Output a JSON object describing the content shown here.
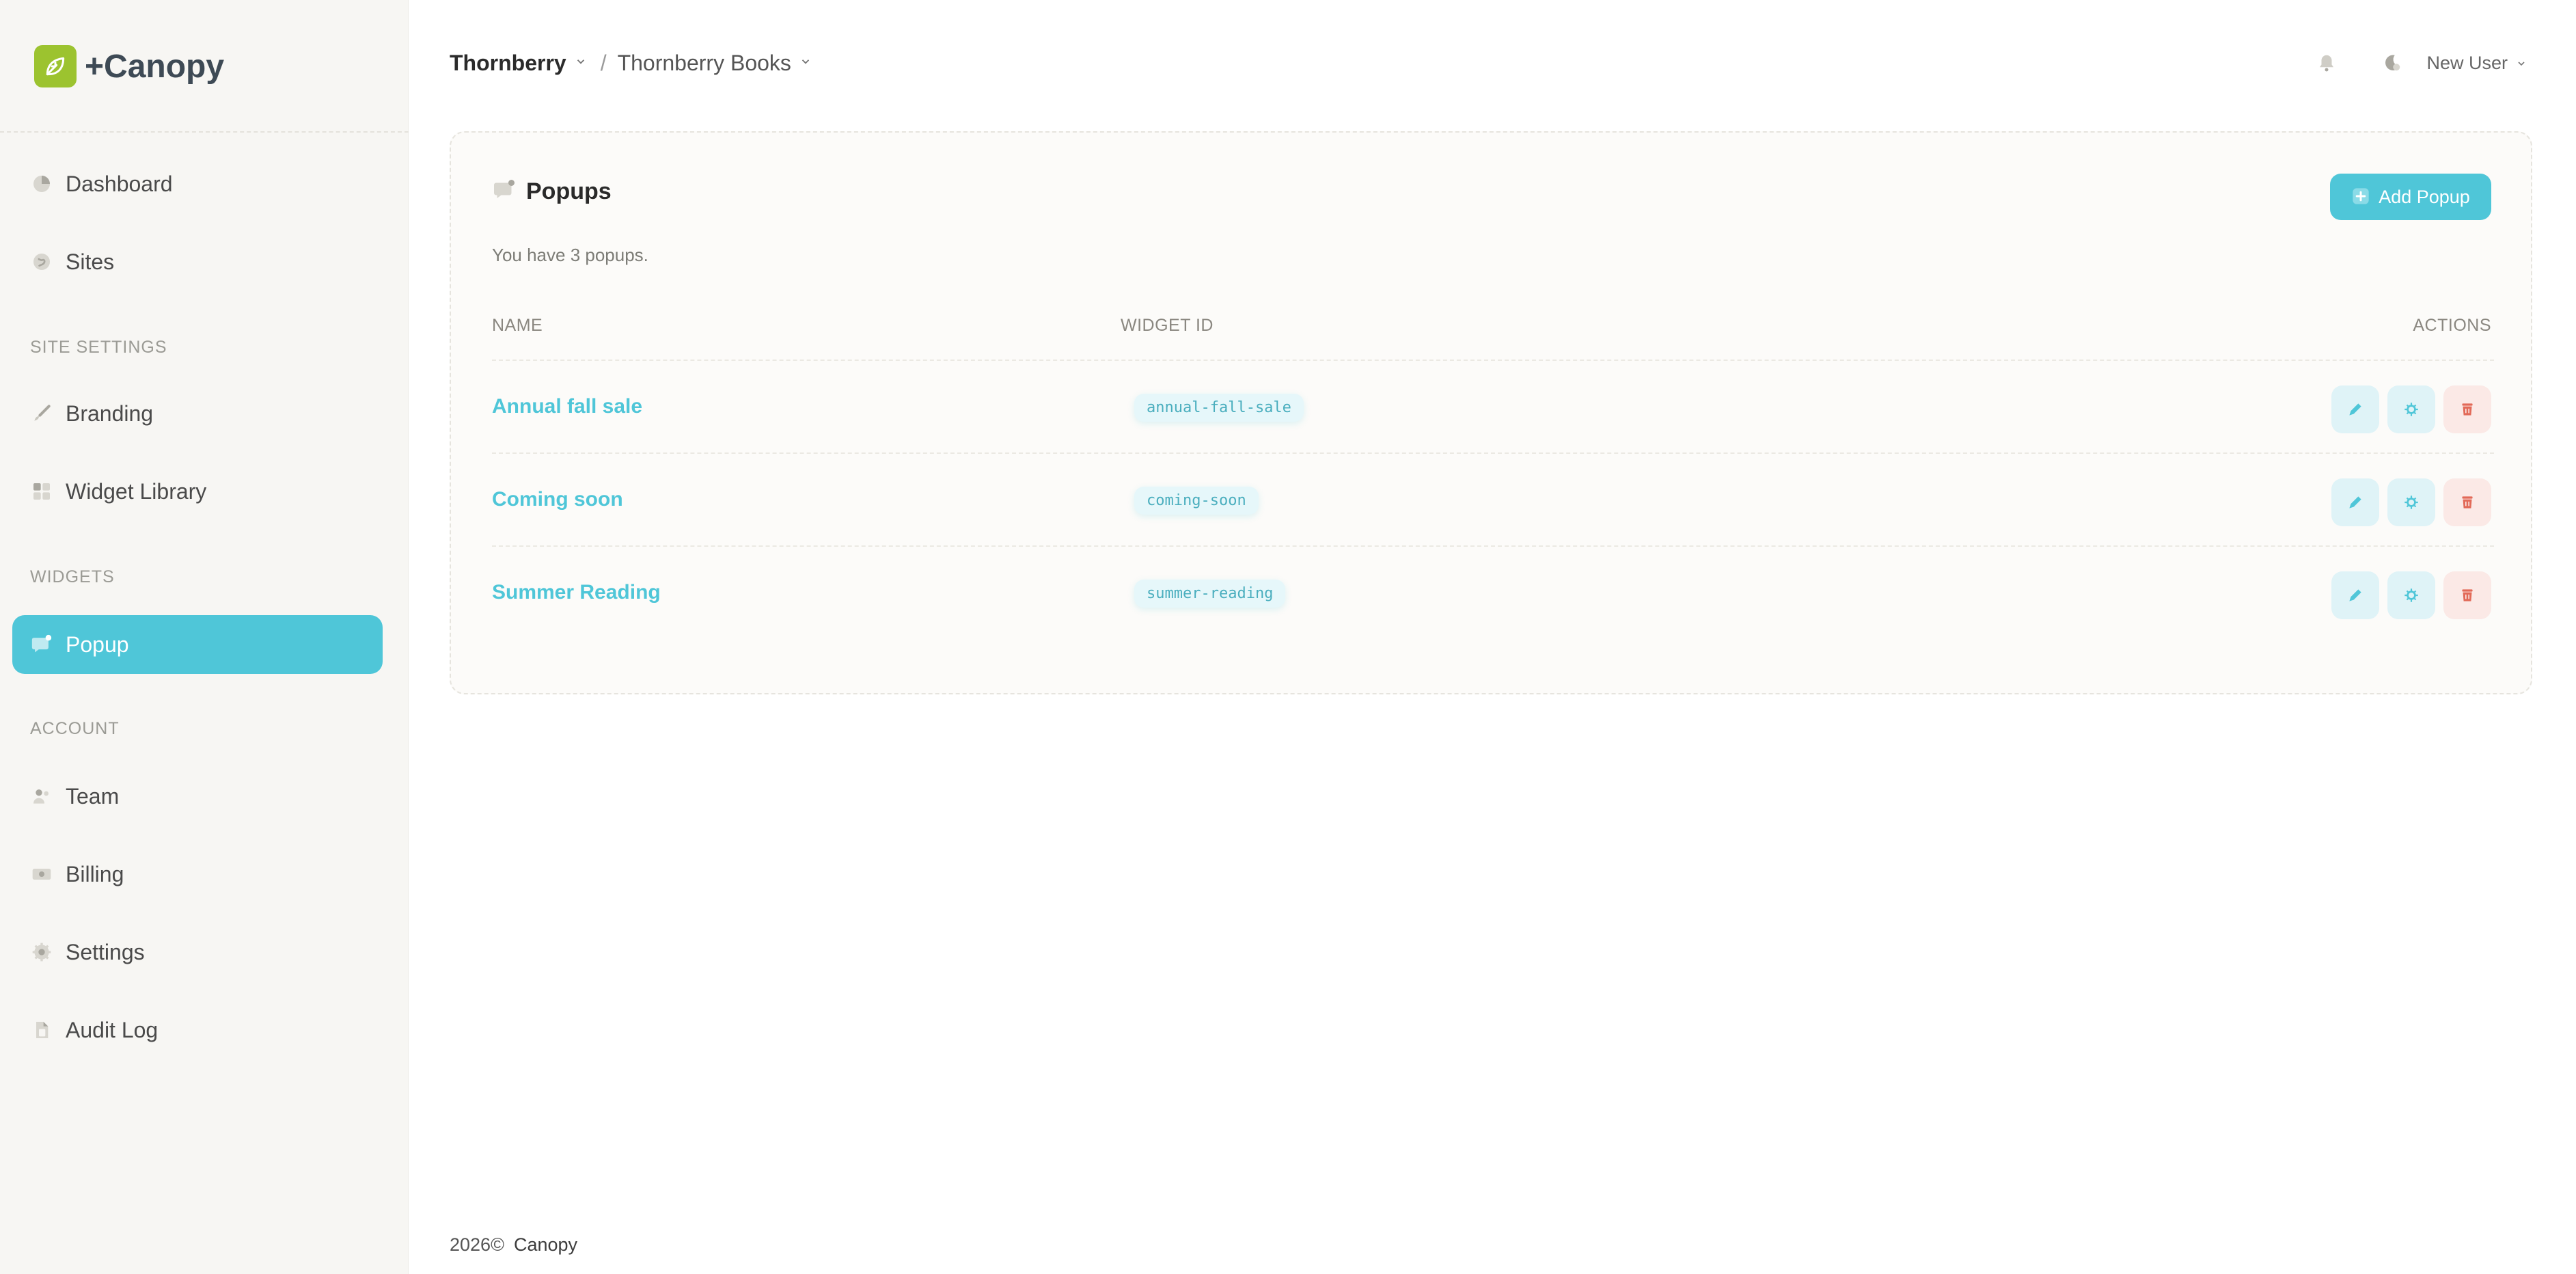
{
  "app": {
    "name": "+Canopy"
  },
  "sidebar": {
    "main": [
      {
        "label": "Dashboard",
        "icon": "pie-chart-icon"
      },
      {
        "label": "Sites",
        "icon": "globe-icon"
      }
    ],
    "sections": {
      "site_settings": "SITE SETTINGS",
      "widgets": "WIDGETS",
      "account": "ACCOUNT"
    },
    "site_settings": [
      {
        "label": "Branding",
        "icon": "brush-icon"
      },
      {
        "label": "Widget Library",
        "icon": "grid-icon"
      }
    ],
    "widgets": [
      {
        "label": "Popup",
        "icon": "chat-bubble-icon",
        "active": true
      }
    ],
    "account": [
      {
        "label": "Team",
        "icon": "users-icon"
      },
      {
        "label": "Billing",
        "icon": "money-icon"
      },
      {
        "label": "Settings",
        "icon": "gear-icon"
      },
      {
        "label": "Audit Log",
        "icon": "document-icon"
      }
    ]
  },
  "header": {
    "org": "Thornberry",
    "separator": "/",
    "site": "Thornberry Books",
    "user": "New User"
  },
  "popups": {
    "title": "Popups",
    "subtitle": "You have 3 popups.",
    "add_label": "Add Popup",
    "columns": {
      "name": "NAME",
      "widget_id": "WIDGET ID",
      "actions": "ACTIONS"
    },
    "rows": [
      {
        "name": "Annual fall sale",
        "widget_id": "annual-fall-sale"
      },
      {
        "name": "Coming soon",
        "widget_id": "coming-soon"
      },
      {
        "name": "Summer Reading",
        "widget_id": "summer-reading"
      }
    ]
  },
  "footer": {
    "year": "2026©",
    "brand": "Canopy"
  },
  "colors": {
    "accent": "#4fc6d8",
    "logo": "#9cc32f",
    "danger": "#e26a58"
  }
}
